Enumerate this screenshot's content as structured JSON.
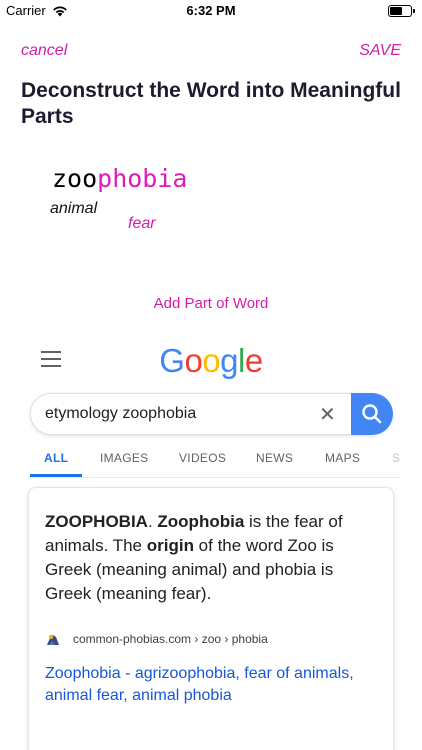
{
  "status_bar": {
    "carrier": "Carrier",
    "time": "6:32 PM",
    "battery_level": 0.6
  },
  "nav": {
    "cancel_label": "cancel",
    "save_label": "SAVE",
    "accent_color": "#d21ea7"
  },
  "heading": "Deconstruct the Word into Meaningful Parts",
  "word_parts": [
    {
      "text": "zoo",
      "meaning": "animal",
      "color": "#000000"
    },
    {
      "text": "phobia",
      "meaning": "fear",
      "color": "#e01ab9"
    }
  ],
  "add_part_label": "Add Part of Word",
  "google": {
    "logo": [
      "G",
      "o",
      "o",
      "g",
      "l",
      "e"
    ],
    "logo_colors": [
      "#4285f4",
      "#ea4335",
      "#fbbc05",
      "#4285f4",
      "#34a853",
      "#ea4335"
    ],
    "query": "etymology zoophobia",
    "tabs": [
      "ALL",
      "IMAGES",
      "VIDEOS",
      "NEWS",
      "MAPS",
      "S"
    ],
    "active_tab": "ALL",
    "snippet": {
      "term": "ZOOPHOBIA",
      "sep": ". ",
      "term2": "Zoophobia",
      "text1": " is the fear of animals. The ",
      "bold": "origin",
      "text2": " of the word Zoo is Greek (meaning animal) and phobia is Greek (meaning fear)."
    },
    "source": "common-phobias.com › zoo › phobia",
    "link": "Zoophobia - agrizoophobia, fear of animals, animal fear, animal phobia"
  }
}
